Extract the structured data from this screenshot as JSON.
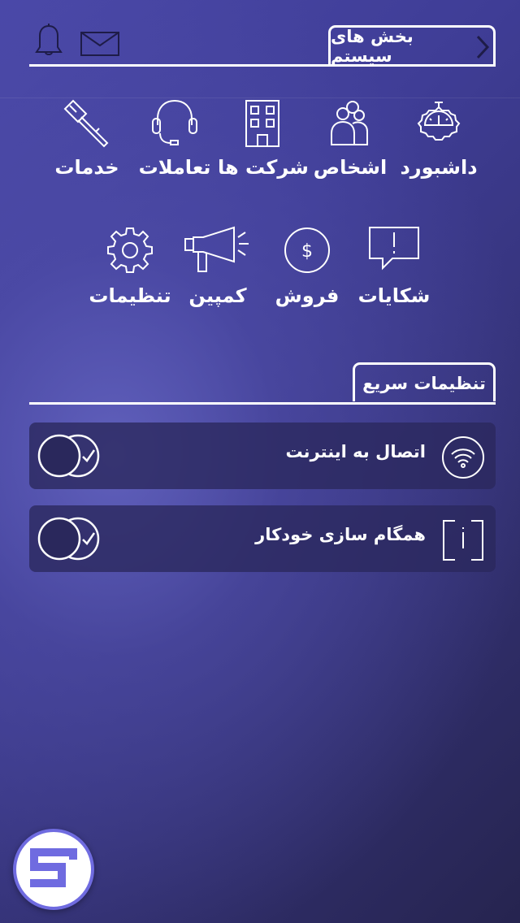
{
  "header": {
    "section_title": "بخش های سیستم",
    "icons": [
      "bell-icon",
      "mail-icon",
      "chevron-right-icon"
    ]
  },
  "modules": [
    {
      "label": "داشبورد",
      "icon": "dashboard-gauge-icon"
    },
    {
      "label": "اشخاص",
      "icon": "people-icon"
    },
    {
      "label": "شرکت ها",
      "icon": "building-icon"
    },
    {
      "label": "تعاملات",
      "icon": "headset-icon"
    },
    {
      "label": "خدمات",
      "icon": "hammer-icon"
    },
    {
      "label": "شکایات",
      "icon": "complaint-bubble-icon"
    },
    {
      "label": "فروش",
      "icon": "dollar-coin-icon"
    },
    {
      "label": "کمپین",
      "icon": "megaphone-icon"
    },
    {
      "label": "تنظیمات",
      "icon": "gear-icon"
    }
  ],
  "quick_settings": {
    "title": "تنظیمات سریع",
    "items": [
      {
        "label": "اتصال به اینترنت",
        "icon": "wifi-icon",
        "enabled": true
      },
      {
        "label": "همگام سازی خودکار",
        "icon": "sync-frame-icon",
        "enabled": true
      }
    ]
  },
  "fab": {
    "icon": "app-logo-icon"
  },
  "colors": {
    "background": "#3f3d96",
    "accent": "#6f6be0",
    "card": "#2a285c"
  }
}
